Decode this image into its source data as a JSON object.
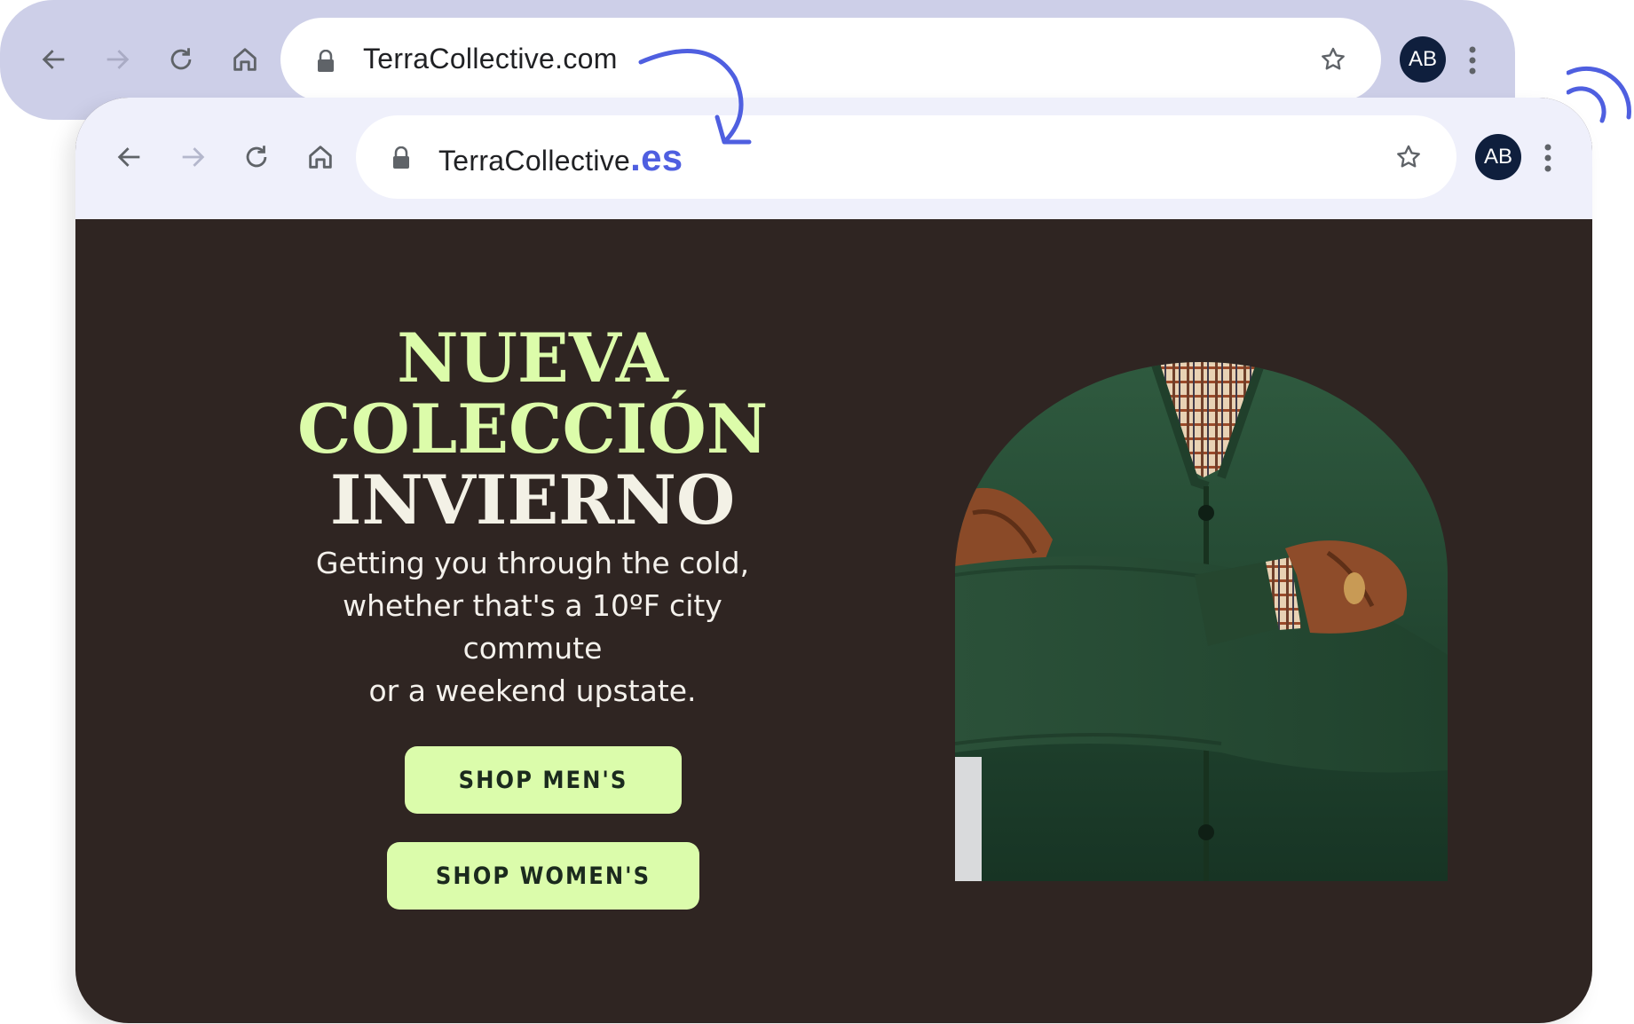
{
  "back_window": {
    "url": "TerraCollective.com",
    "avatar": "AB"
  },
  "front_window": {
    "url_base": "TerraCollective",
    "url_tld": ".es",
    "avatar": "AB"
  },
  "hero": {
    "title_line1": "NUEVA",
    "title_line2": "COLECCIÓN",
    "title_line3": "INVIERNO",
    "subtitle_line1": "Getting you through the cold,",
    "subtitle_line2": "whether that's a 10ºF city commute",
    "subtitle_line3": "or a weekend upstate.",
    "shop_mens": "SHOP MEN'S",
    "shop_womens": "SHOP WOMEN'S"
  },
  "colors": {
    "hero_bg": "#2f2522",
    "title_green": "#dcfcaa",
    "button_bg": "#dbfcab",
    "accent_blue": "#4f5fe0",
    "back_chrome": "#cdcfe8",
    "front_chrome": "#eff0fb"
  },
  "icons": [
    "back-arrow-icon",
    "forward-arrow-icon",
    "reload-icon",
    "home-icon",
    "lock-icon",
    "star-icon",
    "kebab-menu-icon",
    "curved-arrow-icon",
    "signal-arcs-icon"
  ]
}
